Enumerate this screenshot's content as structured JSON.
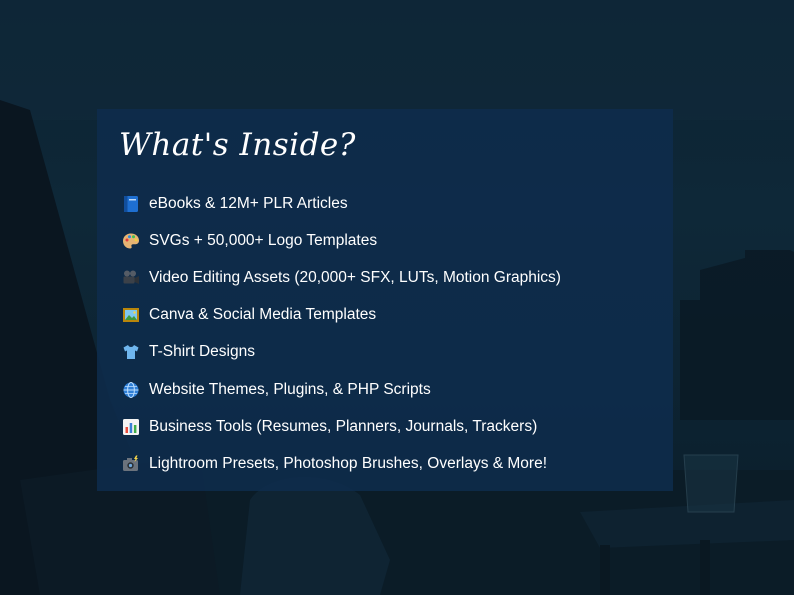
{
  "title": "What's Inside?",
  "items": [
    {
      "icon": "blue-book-icon",
      "label": "eBooks & 12M+ PLR Articles"
    },
    {
      "icon": "artist-palette-icon",
      "label": "SVGs + 50,000+ Logo Templates"
    },
    {
      "icon": "movie-camera-icon",
      "label": "Video Editing Assets (20,000+ SFX, LUTs, Motion Graphics)"
    },
    {
      "icon": "framed-picture-icon",
      "label": "Canva & Social Media Templates"
    },
    {
      "icon": "t-shirt-icon",
      "label": "T-Shirt Designs"
    },
    {
      "icon": "globe-icon",
      "label": "Website Themes, Plugins, & PHP Scripts"
    },
    {
      "icon": "bar-chart-icon",
      "label": "Business Tools (Resumes, Planners, Journals, Trackers)"
    },
    {
      "icon": "camera-flash-icon",
      "label": "Lightroom Presets, Photoshop Brushes, Overlays & More!"
    }
  ],
  "colors": {
    "panel": "#0e2c4d",
    "text": "#ffffff",
    "background": "#0d2433"
  }
}
